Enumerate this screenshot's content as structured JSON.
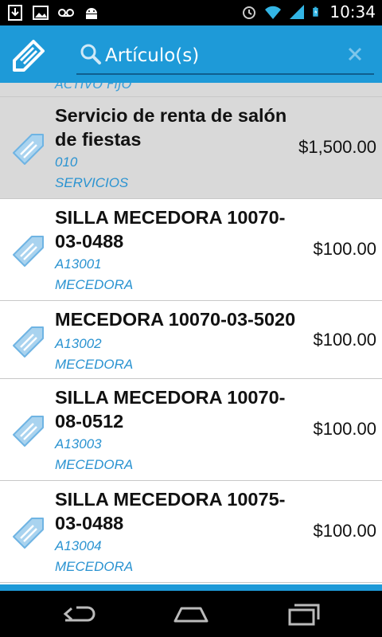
{
  "status_bar": {
    "time": "10:34",
    "left_icons": [
      "download-icon",
      "image-icon",
      "voicemail-icon",
      "android-icon"
    ],
    "right_icons": [
      "alarm-icon",
      "wifi-icon",
      "signal-icon",
      "battery-icon"
    ]
  },
  "action_bar": {
    "icon": "tag-edit-icon",
    "search_placeholder": "Artículo(s)",
    "search_value": "",
    "color": "#1e9ad8"
  },
  "list": {
    "partial_top_text": "ACTIVO FIJO",
    "items": [
      {
        "name": "Servicio de renta de salón de fiestas",
        "code": "010",
        "category": "SERVICIOS",
        "price": "$1,500.00",
        "selected": true
      },
      {
        "name": "SILLA MECEDORA 10070-03-0488",
        "code": "A13001",
        "category": "MECEDORA",
        "price": "$100.00",
        "selected": false
      },
      {
        "name": "MECEDORA 10070-03-5020",
        "code": "A13002",
        "category": "MECEDORA",
        "price": "$100.00",
        "selected": false
      },
      {
        "name": "SILLA MECEDORA 10070-08-0512",
        "code": "A13003",
        "category": "MECEDORA",
        "price": "$100.00",
        "selected": false
      },
      {
        "name": "SILLA MECEDORA 10075-03-0488",
        "code": "A13004",
        "category": "MECEDORA",
        "price": "$100.00",
        "selected": false
      }
    ]
  },
  "nav_bar": {
    "buttons": [
      "back-icon",
      "home-icon",
      "recent-apps-icon"
    ]
  }
}
